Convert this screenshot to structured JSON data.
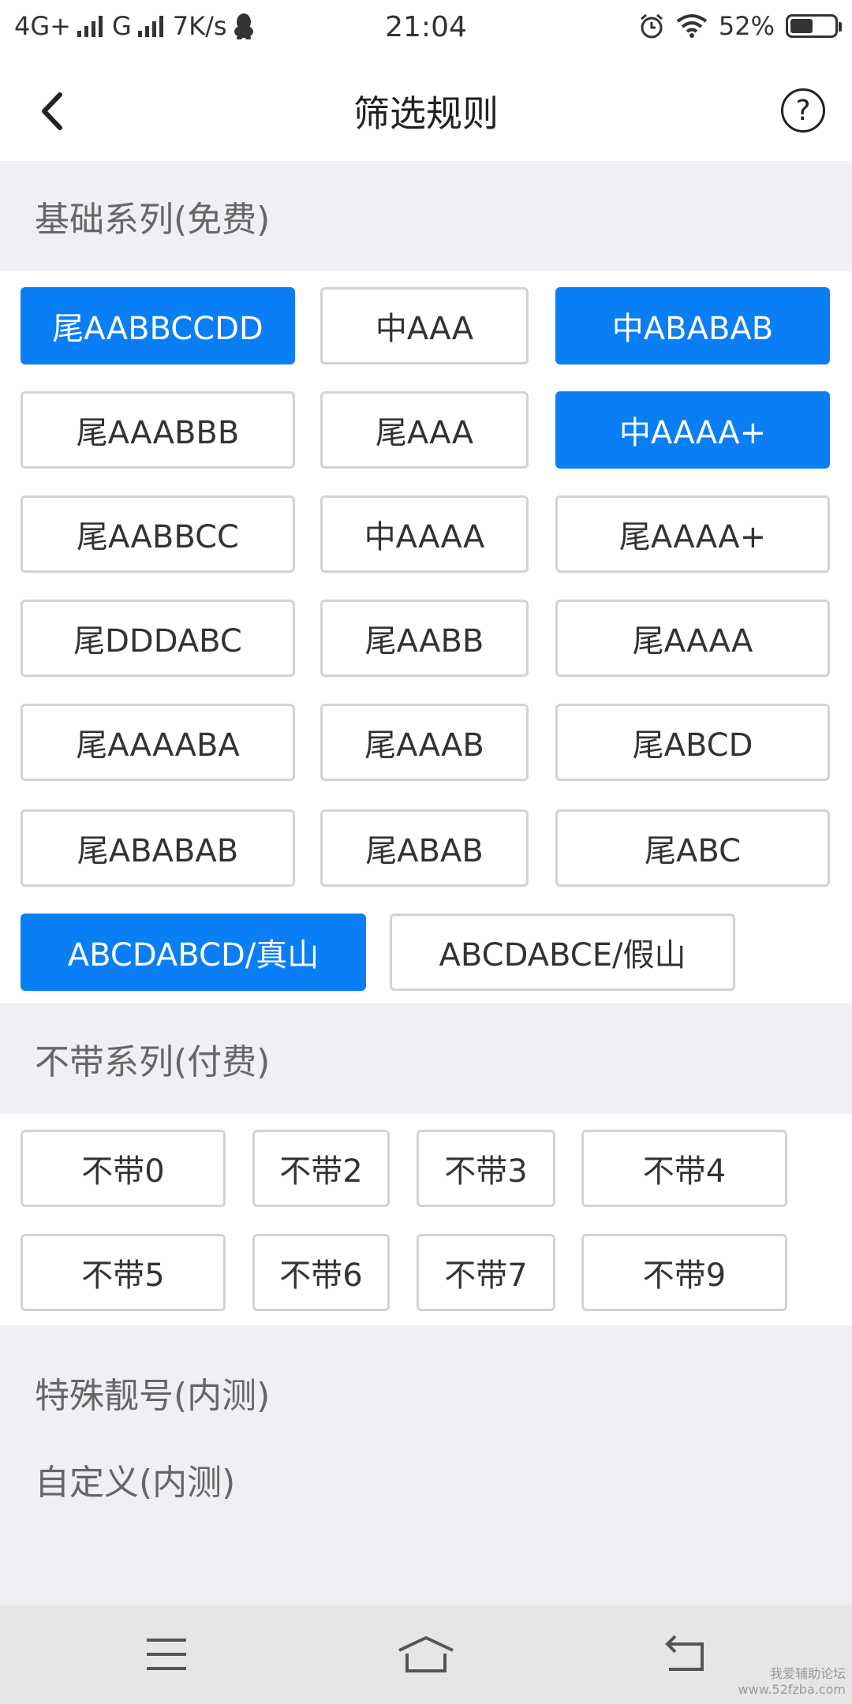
{
  "status_bar": {
    "network1": "4G+",
    "network2": "G",
    "speed": "7K/s",
    "time": "21:04",
    "battery": "52%",
    "battery_level": 0.52,
    "icons": [
      "signal-icon",
      "qq-icon",
      "alarm-icon",
      "wifi-icon",
      "battery-icon"
    ]
  },
  "header": {
    "title": "筛选规则",
    "back_icon": "chevron-left-icon",
    "help_label": "?"
  },
  "sections": {
    "basic_title": "基础系列(免费)",
    "exclude_title": "不带系列(付费)",
    "special_title": "特殊靓号(内测)",
    "custom_title": "自定义(内测)"
  },
  "basic_rules": [
    {
      "label": "尾AABBCCDD",
      "selected": true
    },
    {
      "label": "中AAA",
      "selected": false
    },
    {
      "label": "中ABABAB",
      "selected": true
    },
    {
      "label": "尾AAABBB",
      "selected": false
    },
    {
      "label": "尾AAA",
      "selected": false
    },
    {
      "label": "中AAAA+",
      "selected": true
    },
    {
      "label": "尾AABBCC",
      "selected": false
    },
    {
      "label": "中AAAA",
      "selected": false
    },
    {
      "label": "尾AAAA+",
      "selected": false
    },
    {
      "label": "尾DDDABC",
      "selected": false
    },
    {
      "label": "尾AABB",
      "selected": false
    },
    {
      "label": "尾AAAA",
      "selected": false
    },
    {
      "label": "尾AAAABA",
      "selected": false
    },
    {
      "label": "尾AAAB",
      "selected": false
    },
    {
      "label": "尾ABCD",
      "selected": false
    },
    {
      "label": "尾ABABAB",
      "selected": false
    },
    {
      "label": "尾ABAB",
      "selected": false
    },
    {
      "label": "尾ABC",
      "selected": false
    },
    {
      "label": "ABCDABCD/真山",
      "selected": true
    },
    {
      "label": "ABCDABCE/假山",
      "selected": false
    }
  ],
  "exclude_rules": [
    {
      "label": "不带0",
      "selected": false
    },
    {
      "label": "不带2",
      "selected": false
    },
    {
      "label": "不带3",
      "selected": false
    },
    {
      "label": "不带4",
      "selected": false
    },
    {
      "label": "不带5",
      "selected": false
    },
    {
      "label": "不带6",
      "selected": false
    },
    {
      "label": "不带7",
      "selected": false
    },
    {
      "label": "不带9",
      "selected": false
    }
  ],
  "nav_bar": {
    "icons": [
      "menu-icon",
      "home-icon",
      "back-icon"
    ]
  },
  "watermark": {
    "line1": "我爱辅助论坛",
    "line2": "www.52fzba.com"
  },
  "colors": {
    "accent": "#0a7ef5",
    "section_bg": "#efeff4",
    "chip_border": "#d3d3d3"
  }
}
